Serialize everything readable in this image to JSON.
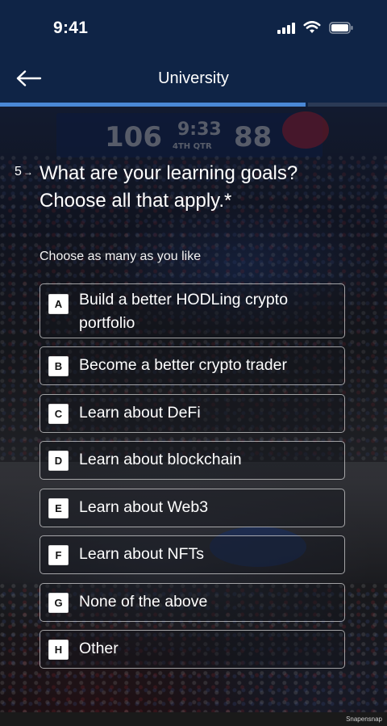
{
  "status_bar": {
    "time": "9:41"
  },
  "nav": {
    "title": "University",
    "back_icon": "arrow-left-icon"
  },
  "progress": {
    "fraction": 0.79
  },
  "question": {
    "number": "5",
    "arrow": "→",
    "text_line1": "What are your learning goals?",
    "text_line2": "Choose all that apply.*",
    "hint": "Choose as many as you like"
  },
  "options": [
    {
      "key": "A",
      "line1": "Build a better HODLing crypto",
      "line2": "portfolio"
    },
    {
      "key": "B",
      "line1": "Become a better crypto trader"
    },
    {
      "key": "C",
      "line1": "Learn about DeFi"
    },
    {
      "key": "D",
      "line1": "Learn about blockchain"
    },
    {
      "key": "E",
      "line1": "Learn about Web3"
    },
    {
      "key": "F",
      "line1": "Learn about NFTs"
    },
    {
      "key": "G",
      "line1": "None of the above"
    },
    {
      "key": "H",
      "line1": "Other"
    }
  ],
  "background": {
    "scoreboard_left": "106",
    "scoreboard_clock": "9:33",
    "scoreboard_period": "4TH QTR",
    "scoreboard_right": "88"
  },
  "watermark": "Snapensnap",
  "colors": {
    "header_bg": "#0f2446",
    "progress_fill": "#4a88d6",
    "option_border": "#ffffff"
  }
}
